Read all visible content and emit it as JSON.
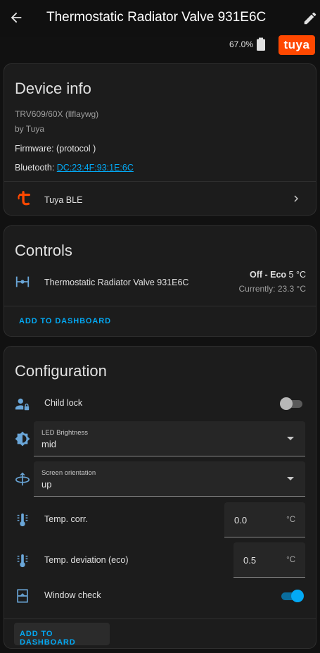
{
  "header": {
    "title": "Thermostatic Radiator Valve 931E6C"
  },
  "status": {
    "battery": "67.0%",
    "brand_logo_text": "tuya"
  },
  "device_info": {
    "title": "Device info",
    "model": "TRV609/60X (llflaywg)",
    "manufacturer": "by Tuya",
    "firmware": "Firmware: (protocol )",
    "bluetooth_label": "Bluetooth:",
    "bluetooth_mac": "DC:23:4F:93:1E:6C",
    "integration": "Tuya BLE"
  },
  "controls": {
    "title": "Controls",
    "entity_name": "Thermostatic Radiator Valve 931E6C",
    "state_mode": "Off - Eco",
    "state_target": "5 °C",
    "current": "Currently: 23.3 °C",
    "add_to_dashboard": "ADD TO DASHBOARD"
  },
  "configuration": {
    "title": "Configuration",
    "child_lock": {
      "label": "Child lock",
      "on": false
    },
    "led_brightness": {
      "label": "LED Brightness",
      "value": "mid"
    },
    "screen_orientation": {
      "label": "Screen orientation",
      "value": "up"
    },
    "temp_corr": {
      "label": "Temp. corr.",
      "value": "0.0",
      "unit": "°C"
    },
    "temp_deviation": {
      "label": "Temp. deviation (eco)",
      "value": "0.5",
      "unit": "°C"
    },
    "window_check": {
      "label": "Window check",
      "on": true
    },
    "add_to_dashboard": "ADD TO DASHBOARD"
  },
  "icons": [
    "arrow-left-icon",
    "pencil-icon",
    "battery-icon",
    "tuya-logo",
    "tuya-ble-icon",
    "chevron-right-icon",
    "valve-icon",
    "account-lock-icon",
    "brightness-icon",
    "screen-rotation-icon",
    "thermometer-icon",
    "window-icon"
  ],
  "colors": {
    "accent": "#03a9f4",
    "brand": "#ff4800",
    "card": "#1c1c1c",
    "background": "#111111"
  }
}
